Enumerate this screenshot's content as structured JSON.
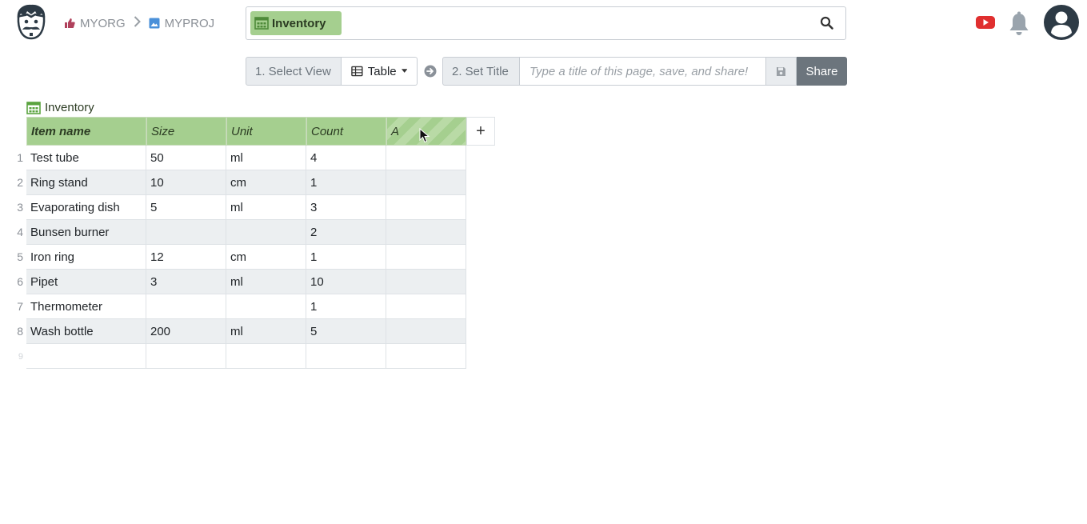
{
  "header": {
    "org": "MYORG",
    "project": "MYPROJ",
    "search_chip": "Inventory"
  },
  "toolbar": {
    "step1": "1. Select View",
    "view": "Table",
    "step2": "2. Set Title",
    "title_placeholder": "Type a title of this page, save, and share!",
    "share": "Share"
  },
  "table": {
    "caption": "Inventory",
    "columns": [
      "Item name",
      "Size",
      "Unit",
      "Count",
      "A"
    ],
    "rows": [
      {
        "num": "1",
        "cells": [
          "Test tube",
          "50",
          "ml",
          "4",
          ""
        ]
      },
      {
        "num": "2",
        "cells": [
          "Ring stand",
          "10",
          "cm",
          "1",
          ""
        ]
      },
      {
        "num": "3",
        "cells": [
          "Evaporating dish",
          "5",
          "ml",
          "3",
          ""
        ]
      },
      {
        "num": "4",
        "cells": [
          "Bunsen burner",
          "",
          "",
          "2",
          ""
        ]
      },
      {
        "num": "5",
        "cells": [
          "Iron ring",
          "12",
          "cm",
          "1",
          ""
        ]
      },
      {
        "num": "6",
        "cells": [
          "Pipet",
          "3",
          "ml",
          "10",
          ""
        ]
      },
      {
        "num": "7",
        "cells": [
          "Thermometer",
          "",
          "",
          "1",
          ""
        ]
      },
      {
        "num": "8",
        "cells": [
          "Wash bottle",
          "200",
          "ml",
          "5",
          ""
        ]
      },
      {
        "num": "9",
        "cells": [
          "",
          "",
          "",
          "",
          ""
        ]
      }
    ],
    "add_column": "+"
  },
  "icons": {
    "logo": "mustache-face-logo",
    "org": "thumbs-up-icon",
    "project": "image-icon",
    "table": "table-grid-icon",
    "search": "search-icon",
    "youtube": "youtube-icon",
    "bell": "bell-icon",
    "avatar": "user-avatar-icon"
  },
  "colors": {
    "accent_green": "#a5cf8f",
    "share_gray": "#6c757d",
    "youtube_red": "#e02f2f"
  }
}
